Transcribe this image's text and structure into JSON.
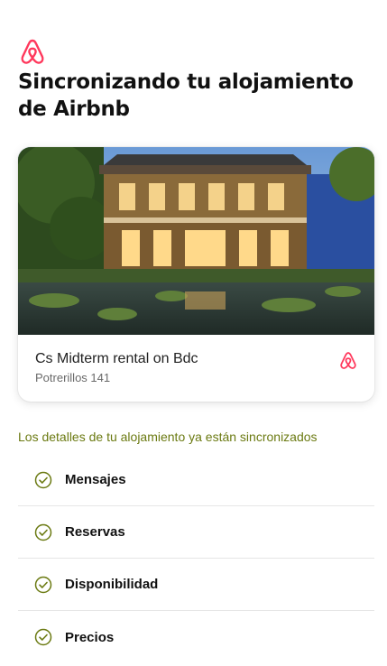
{
  "header": {
    "logo_icon": "airbnb-logo-icon",
    "title": "Sincronizando tu alojamiento de Airbnb"
  },
  "listing": {
    "name": "Cs Midterm rental on Bdc",
    "address": "Potrerillos 141",
    "image": "house-photo",
    "platform_icon": "airbnb-logo-icon"
  },
  "sync": {
    "note": "Los detalles de tu alojamiento ya están sincronizados",
    "items": [
      {
        "label": "Mensajes",
        "icon": "check-circle-icon"
      },
      {
        "label": "Reservas",
        "icon": "check-circle-icon"
      },
      {
        "label": "Disponibilidad",
        "icon": "check-circle-icon"
      },
      {
        "label": "Precios",
        "icon": "check-circle-icon"
      }
    ]
  },
  "colors": {
    "brand": "#ff385c",
    "success": "#6b7a12",
    "text": "#222222"
  }
}
